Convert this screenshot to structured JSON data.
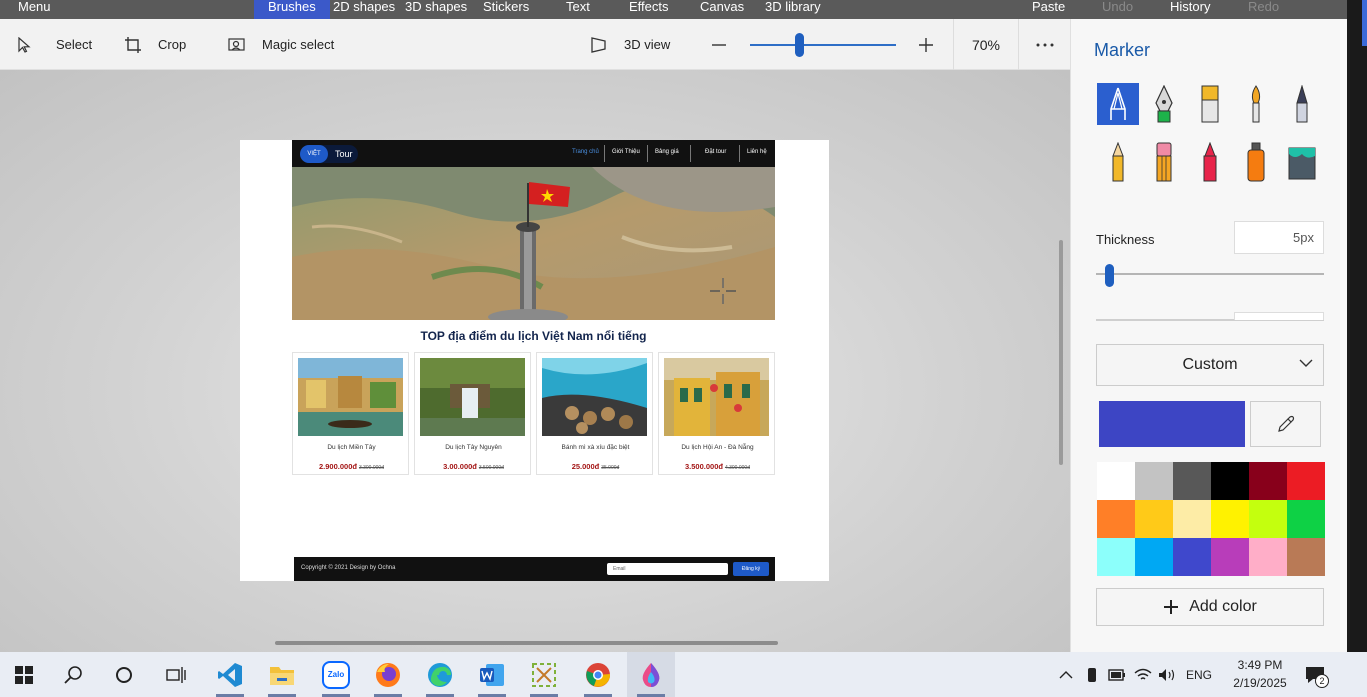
{
  "menubar": {
    "menu": "Menu",
    "tabs": [
      "Brushes",
      "2D shapes",
      "3D shapes",
      "Stickers",
      "Text",
      "Effects",
      "Canvas",
      "3D library"
    ],
    "actions": [
      "Paste",
      "Undo",
      "History",
      "Redo"
    ]
  },
  "toolbar": {
    "select": "Select",
    "crop": "Crop",
    "magic_select": "Magic select",
    "view_3d": "3D view",
    "zoom_percent": "70%",
    "zoom_level": 0.35
  },
  "website": {
    "logo_left": "VIỆT",
    "logo_right": "Tour",
    "nav": [
      "Trang chủ",
      "Giới Thiệu",
      "Bảng giá",
      "Đặt tour",
      "Liên hệ"
    ],
    "section_title": "TOP địa điểm du lịch Việt Nam nổi tiếng",
    "cards": [
      {
        "name": "Du lịch Miền Tây",
        "price": "2.900.000đ",
        "old_price": "3.300.000đ"
      },
      {
        "name": "Du lịch Tây Nguyên",
        "price": "3.00.000đ",
        "old_price": "3.500.000đ"
      },
      {
        "name": "Bánh mì xà xíu đặc biệt",
        "price": "25.000đ",
        "old_price": "35.000đ"
      },
      {
        "name": "Du lịch Hội An - Đà Nẵng",
        "price": "3.500.000đ",
        "old_price": "4.300.000đ"
      }
    ],
    "footer_copy": "Copyright © 2021 Design by Ochna",
    "footer_email": "Email",
    "footer_button": "Đăng ký"
  },
  "panel": {
    "title": "Marker",
    "thickness_label": "Thickness",
    "thickness_value": "5px",
    "thickness_level": 0.04,
    "dropdown": "Custom",
    "current_color": "#3d45c4",
    "palette": [
      "#ffffff",
      "#c3c3c3",
      "#585858",
      "#000000",
      "#88001b",
      "#ec1c24",
      "#ff7f27",
      "#ffca18",
      "#fdeca6",
      "#fff200",
      "#c4ff0e",
      "#0ed145",
      "#8cfffb",
      "#00a8f3",
      "#3f48cc",
      "#b83dba",
      "#ffaec8",
      "#b97a56"
    ],
    "add_color": "Add color",
    "brush_icons": [
      "marker-icon",
      "calligraphy-pen-icon",
      "oil-brush-icon",
      "watercolor-icon",
      "pixel-pen-icon",
      "pencil-icon",
      "eraser-icon",
      "crayon-icon",
      "spray-can-icon",
      "fill-bucket-icon"
    ]
  },
  "taskbar": {
    "apps": [
      "start-icon",
      "search-icon",
      "cortana-icon",
      "task-view-icon",
      "vscode-icon",
      "file-explorer-icon",
      "zalo-icon",
      "firefox-icon",
      "edge-icon",
      "word-icon",
      "snipping-icon",
      "chrome-icon",
      "paint3d-icon"
    ],
    "zalo_label": "Zalo",
    "language": "ENG",
    "time": "3:49 PM",
    "date": "2/19/2025",
    "notification_count": "2"
  }
}
